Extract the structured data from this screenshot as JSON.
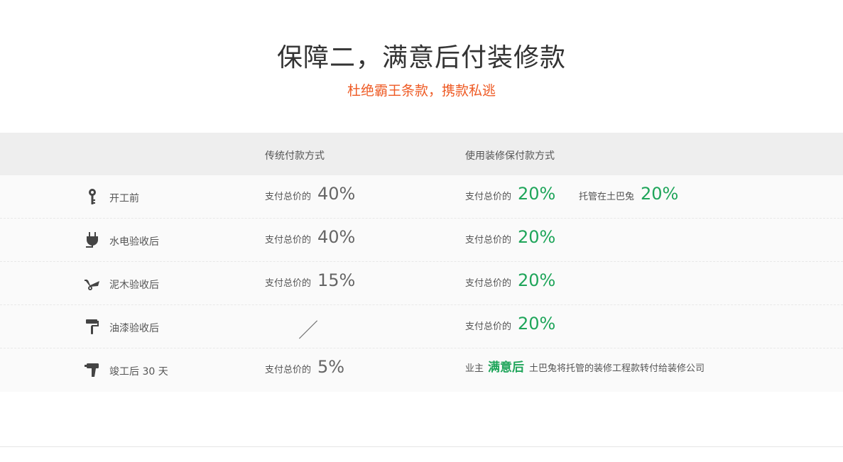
{
  "header": {
    "title": "保障二，满意后付装修款",
    "subtitle": "杜绝霸王条款，携款私逃"
  },
  "table": {
    "col_traditional": "传统付款方式",
    "col_guarantee": "使用装修保付款方式",
    "pay_label": "支付总价的",
    "rows": [
      {
        "stage": "开工前",
        "icon": "key-icon",
        "traditional": "40%",
        "guarantee": "20%",
        "escrow_label": "托管在土巴兔",
        "escrow": "20%"
      },
      {
        "stage": "水电验收后",
        "icon": "plug-icon",
        "traditional": "40%",
        "guarantee": "20%"
      },
      {
        "stage": "泥木验收后",
        "icon": "wheelbarrow-icon",
        "traditional": "15%",
        "guarantee": "20%"
      },
      {
        "stage": "油漆验收后",
        "icon": "paint-roller-icon",
        "traditional_slash": "／",
        "guarantee": "20%"
      },
      {
        "stage": "竣工后 30 天",
        "icon": "drill-icon",
        "traditional": "5%",
        "final_owner": "业主",
        "final_satisfied": "满意后",
        "final_text": "土巴兔将托管的装修工程款转付给装修公司"
      }
    ]
  },
  "colors": {
    "accent_orange": "#ee5a24",
    "accent_green": "#1fa55a"
  }
}
